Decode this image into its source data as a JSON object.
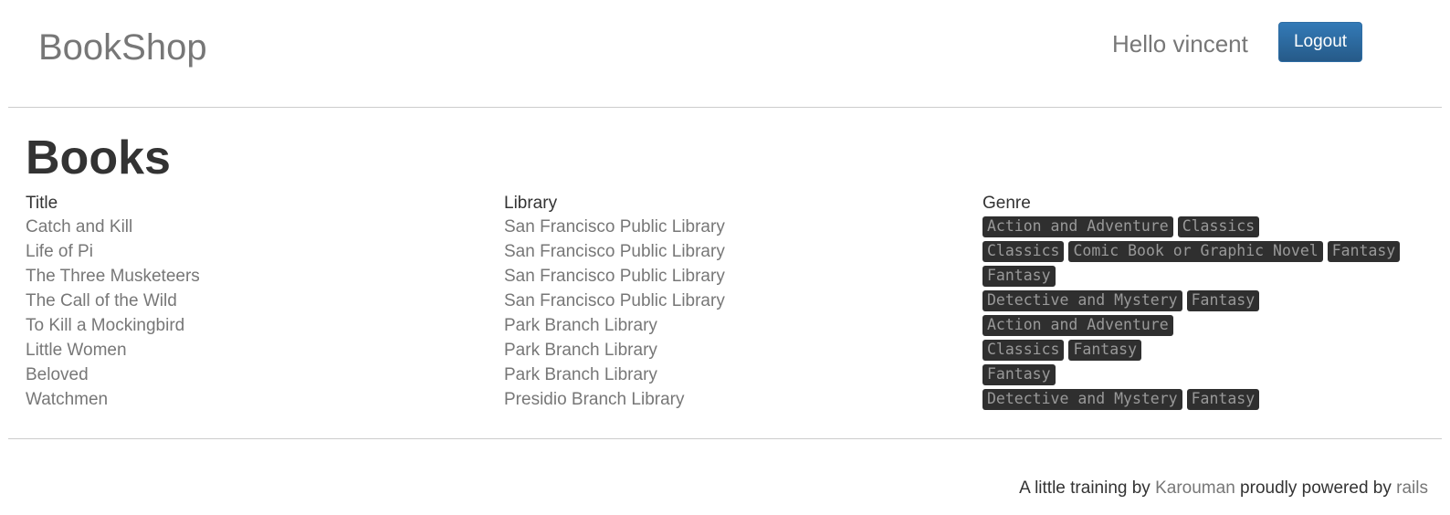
{
  "header": {
    "brand": "BookShop",
    "greeting": "Hello vincent",
    "logout_label": "Logout"
  },
  "page_title": "Books",
  "table": {
    "columns": [
      "Title",
      "Library",
      "Genre"
    ],
    "rows": [
      {
        "title": "Catch and Kill",
        "library": "San Francisco Public Library",
        "genres": [
          "Action and Adventure",
          "Classics"
        ]
      },
      {
        "title": "Life of Pi",
        "library": "San Francisco Public Library",
        "genres": [
          "Classics",
          "Comic Book or Graphic Novel",
          "Fantasy"
        ]
      },
      {
        "title": "The Three Musketeers",
        "library": "San Francisco Public Library",
        "genres": [
          "Fantasy"
        ]
      },
      {
        "title": "The Call of the Wild",
        "library": "San Francisco Public Library",
        "genres": [
          "Detective and Mystery",
          "Fantasy"
        ]
      },
      {
        "title": "To Kill a Mockingbird",
        "library": "Park Branch Library",
        "genres": [
          "Action and Adventure"
        ]
      },
      {
        "title": "Little Women",
        "library": "Park Branch Library",
        "genres": [
          "Classics",
          "Fantasy"
        ]
      },
      {
        "title": "Beloved",
        "library": "Park Branch Library",
        "genres": [
          "Fantasy"
        ]
      },
      {
        "title": "Watchmen",
        "library": "Presidio Branch Library",
        "genres": [
          "Detective and Mystery",
          "Fantasy"
        ]
      }
    ]
  },
  "footer": {
    "prefix": "A little training by ",
    "author_link": "Karouman",
    "middle": " proudly powered by ",
    "rails_link": "rails"
  },
  "colors": {
    "primary_button": "#337ab7",
    "tag_background": "#2f2f2f",
    "muted_text": "#777777"
  }
}
